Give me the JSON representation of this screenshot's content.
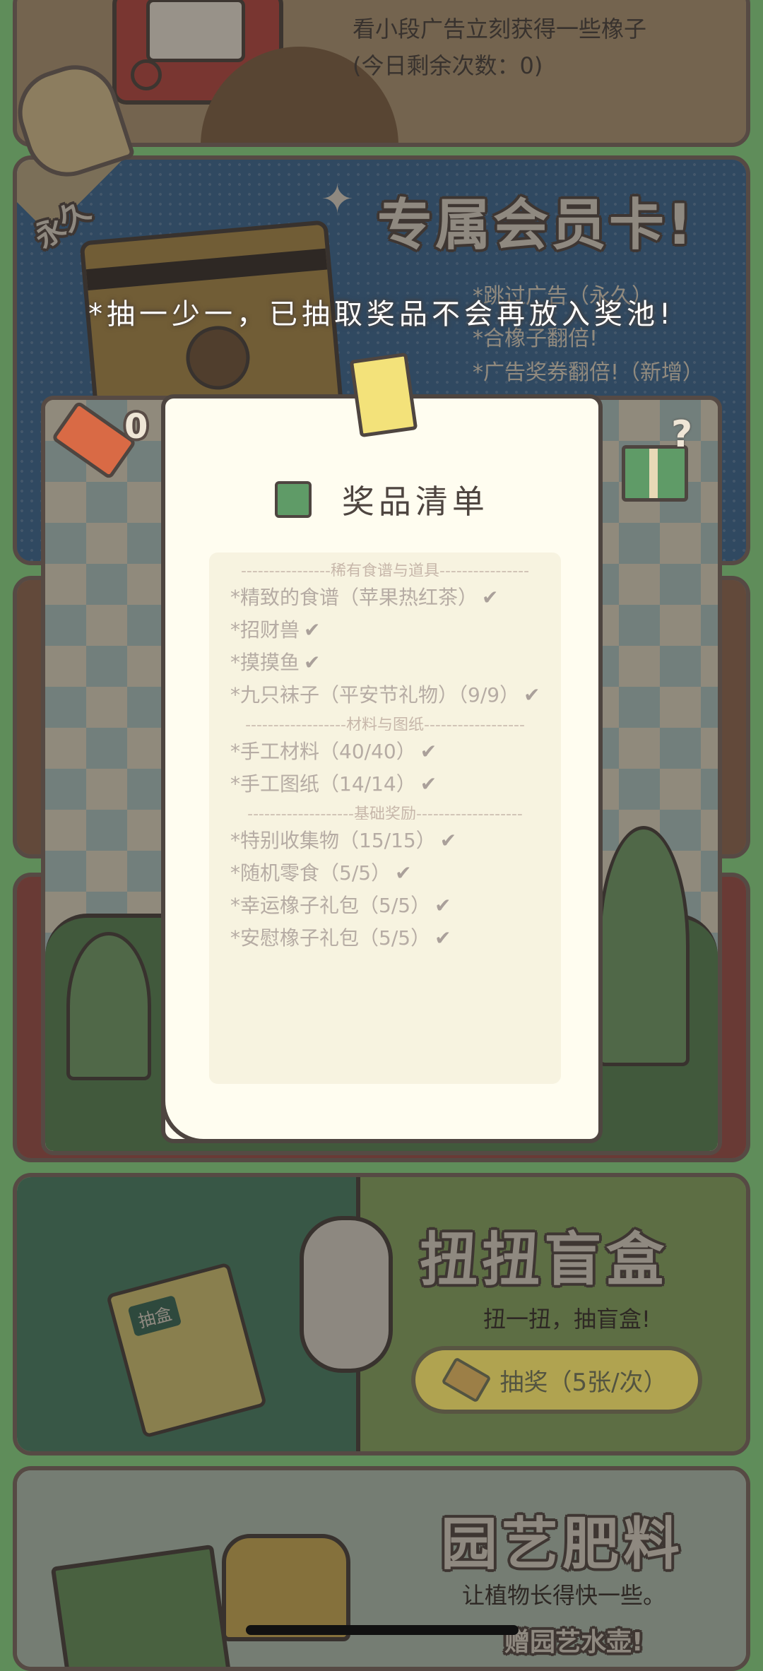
{
  "ad_card": {
    "line1": "看小段广告立刻获得一些橡子",
    "line2": "(今日剩余次数：0)"
  },
  "vip_card": {
    "badge": "永久",
    "title": "专属会员卡!",
    "perks": [
      "*跳过广告（永久）",
      "*合橡子翻倍!",
      "*广告奖券翻倍!（新增）"
    ]
  },
  "notice": "*抽一少一，已抽取奖品不会再放入奖池!",
  "ticket_count": "0",
  "prize_list": {
    "title": "奖品清单",
    "sections": [
      {
        "header": "稀有食谱与道具",
        "items": [
          "*精致的食谱（苹果热红茶）",
          "*招财兽",
          "*摸摸鱼",
          "*九只袜子（平安节礼物）（9/9）"
        ]
      },
      {
        "header": "材料与图纸",
        "items": [
          "*手工材料（40/40）",
          "*手工图纸（14/14）"
        ]
      },
      {
        "header": "基础奖励",
        "items": [
          "*特别收集物（15/15）",
          "*随机零食（5/5）",
          "*幸运橡子礼包（5/5）",
          "*安慰橡子礼包（5/5）"
        ]
      }
    ]
  },
  "gacha_card": {
    "title": "扭扭盲盒",
    "subtitle": "扭一扭，抽盲盒!",
    "button": "抽奖（5张/次）",
    "box_label": "抽盒"
  },
  "garden_card": {
    "title": "园艺肥料",
    "subtitle": "让植物长得快一些。",
    "bonus": "赠园艺水壶!"
  },
  "colors": {
    "overlay": "#1e1c1a",
    "paper": "#fffdf0",
    "accent": "#e4c458",
    "outline": "#564a44"
  }
}
